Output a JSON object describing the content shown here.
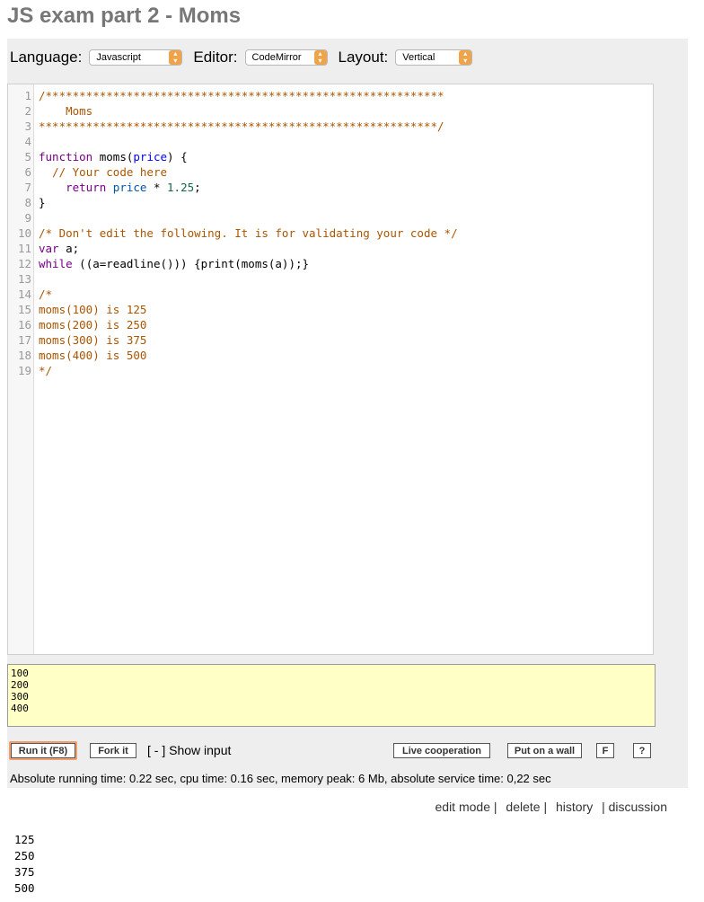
{
  "page": {
    "title": "JS exam part 2 - Moms"
  },
  "toolbar": {
    "language_label": "Language:",
    "language_value": "Javascript",
    "editor_label": "Editor:",
    "editor_value": "CodeMirror",
    "layout_label": "Layout:",
    "layout_value": "Vertical"
  },
  "code_lines": [
    {
      "n": "1",
      "parts": [
        [
          "comment",
          "/***********************************************************"
        ]
      ]
    },
    {
      "n": "2",
      "parts": [
        [
          "comment",
          "    Moms"
        ]
      ]
    },
    {
      "n": "3",
      "parts": [
        [
          "comment",
          "***********************************************************/"
        ]
      ]
    },
    {
      "n": "4",
      "parts": []
    },
    {
      "n": "5",
      "parts": [
        [
          "keyword",
          "function"
        ],
        [
          "plain",
          " "
        ],
        [
          "plain",
          "moms"
        ],
        [
          "plain",
          "("
        ],
        [
          "def",
          "price"
        ],
        [
          "plain",
          ") {"
        ]
      ]
    },
    {
      "n": "6",
      "parts": [
        [
          "plain",
          "  "
        ],
        [
          "comment",
          "// Your code here"
        ]
      ]
    },
    {
      "n": "7",
      "parts": [
        [
          "plain",
          "    "
        ],
        [
          "keyword",
          "return"
        ],
        [
          "plain",
          " "
        ],
        [
          "var",
          "price"
        ],
        [
          "plain",
          " * "
        ],
        [
          "num",
          "1.25"
        ],
        [
          "plain",
          ";"
        ]
      ]
    },
    {
      "n": "8",
      "parts": [
        [
          "plain",
          "}"
        ]
      ]
    },
    {
      "n": "9",
      "parts": []
    },
    {
      "n": "10",
      "parts": [
        [
          "comment",
          "/* Don't edit the following. It is for validating your code */"
        ]
      ]
    },
    {
      "n": "11",
      "parts": [
        [
          "keyword",
          "var"
        ],
        [
          "plain",
          " a;"
        ]
      ]
    },
    {
      "n": "12",
      "parts": [
        [
          "keyword",
          "while"
        ],
        [
          "plain",
          " ((a=readline())) {print(moms(a));}"
        ]
      ]
    },
    {
      "n": "13",
      "parts": []
    },
    {
      "n": "14",
      "parts": [
        [
          "comment",
          "/*"
        ]
      ]
    },
    {
      "n": "15",
      "parts": [
        [
          "comment",
          "moms(100) is 125"
        ]
      ]
    },
    {
      "n": "16",
      "parts": [
        [
          "comment",
          "moms(200) is 250"
        ]
      ]
    },
    {
      "n": "17",
      "parts": [
        [
          "comment",
          "moms(300) is 375"
        ]
      ]
    },
    {
      "n": "18",
      "parts": [
        [
          "comment",
          "moms(400) is 500"
        ]
      ]
    },
    {
      "n": "19",
      "parts": [
        [
          "comment",
          "*/"
        ]
      ]
    }
  ],
  "input": {
    "value": "100\n200\n300\n400"
  },
  "buttons": {
    "run": "Run it (F8)",
    "fork": "Fork it",
    "show_input": "[ - ] Show input",
    "live": "Live cooperation",
    "wall": "Put on a wall",
    "f": "F",
    "help": "?"
  },
  "status": "Absolute running time: 0.22 sec, cpu time: 0.16 sec, memory peak: 6 Mb, absolute service time: 0,22 sec",
  "links": {
    "edit": "edit mode |",
    "delete": "delete |",
    "history": "history",
    "discussion": "| discussion"
  },
  "output": "125\n250\n375\n500"
}
